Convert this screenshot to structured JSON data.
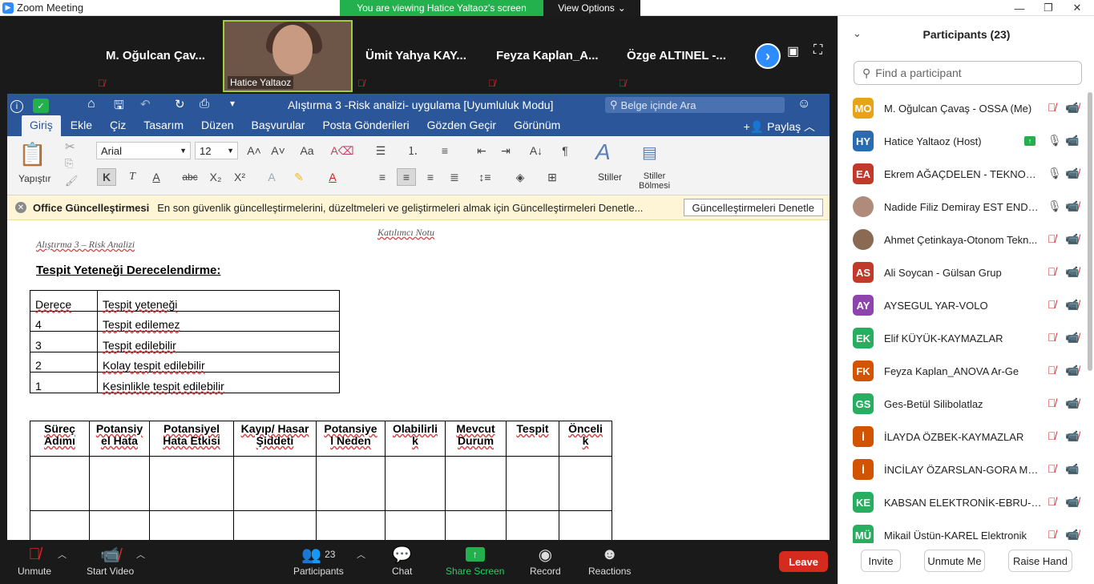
{
  "window": {
    "title": "Zoom Meeting"
  },
  "banner": {
    "viewing": "You are viewing Hatice Yaltaoz's screen",
    "view_options": "View Options"
  },
  "video_strip": {
    "tiles": [
      {
        "name": "M. Oğulcan Çav..."
      },
      {
        "name": "Hatice Yaltaoz"
      },
      {
        "name": "Ümit Yahya KAY..."
      },
      {
        "name": "Feyza  Kaplan_A..."
      },
      {
        "name": "Özge ALTINEL -..."
      }
    ]
  },
  "word": {
    "doc_title": "Alıştırma 3 -Risk analizi- uygulama [Uyumluluk Modu]",
    "search_placeholder": "Belge içinde Ara",
    "tabs": [
      "Giriş",
      "Ekle",
      "Çiz",
      "Tasarım",
      "Düzen",
      "Başvurular",
      "Posta Gönderileri",
      "Gözden Geçir",
      "Görünüm"
    ],
    "share": "Paylaş",
    "ribbon": {
      "paste": "Yapıştır",
      "font": "Arial",
      "size": "12",
      "styles": "Stiller",
      "styles_pane_1": "Stiller",
      "styles_pane_2": "Bölmesi"
    },
    "notice": {
      "title": "Office Güncelleştirmesi",
      "text": "En son güvenlik güncelleştirmelerini, düzeltmeleri ve geliştirmeleri almak için Güncelleştirmeleri Denetle...",
      "button": "Güncelleştirmeleri Denetle"
    },
    "page": {
      "header_left": "Alıştırma 3 – Risk Analizi",
      "header_right": "Katılımcı Notu",
      "heading": "Tespit Yeteneği Derecelendirme:",
      "table1": [
        [
          "Derece",
          "Tespit yeteneği"
        ],
        [
          "4",
          "Tespit edilemez"
        ],
        [
          "3",
          "Tespit edilebilir"
        ],
        [
          "2",
          "Kolay tespit edilebilir"
        ],
        [
          "1",
          "Kesinlikle tespit edilebilir"
        ]
      ],
      "table2_headers": [
        [
          "Süreç",
          "Adımı"
        ],
        [
          "Potansiy",
          "el Hata"
        ],
        [
          "Potansiyel",
          "Hata Etkisi"
        ],
        [
          "Kayıp/ Hasar",
          "Şiddeti"
        ],
        [
          "Potansiye",
          "l Neden"
        ],
        [
          "Olabilirli",
          "k"
        ],
        [
          "Mevcut",
          "Durum"
        ],
        [
          "Tespit",
          ""
        ],
        [
          "Önceli",
          "k"
        ]
      ]
    }
  },
  "participants": {
    "header": "Participants (23)",
    "search_placeholder": "Find a participant",
    "list": [
      {
        "initials": "MO",
        "name": "M. Oğulcan Çavaş - OSSA (Me)",
        "color": "#e8a317",
        "mic": "muted",
        "cam": "off"
      },
      {
        "initials": "HY",
        "name": "Hatice Yaltaoz (Host)",
        "color": "#2b6cb0",
        "mic": "on",
        "cam": "on",
        "sharing": true
      },
      {
        "initials": "EA",
        "name": "Ekrem AĞAÇDELEN - TEKNOKAR",
        "color": "#c0392b",
        "mic": "on",
        "cam": "off"
      },
      {
        "initials": "",
        "name": "Nadide Filiz Demiray EST ENDÜ...",
        "color": "#b08a7a",
        "mic": "on",
        "cam": "off",
        "photo": true
      },
      {
        "initials": "",
        "name": "Ahmet Çetinkaya-Otonom Tekn...",
        "color": "#8a6a52",
        "mic": "muted",
        "cam": "off",
        "photo": true
      },
      {
        "initials": "AS",
        "name": "Ali Soycan - Gülsan Grup",
        "color": "#c0392b",
        "mic": "muted",
        "cam": "off"
      },
      {
        "initials": "AY",
        "name": "AYSEGUL YAR-VOLO",
        "color": "#8e44ad",
        "mic": "muted",
        "cam": "off"
      },
      {
        "initials": "EK",
        "name": "Elif KÜYÜK-KAYMAZLAR",
        "color": "#27ae60",
        "mic": "muted",
        "cam": "off"
      },
      {
        "initials": "FK",
        "name": "Feyza Kaplan_ANOVA Ar-Ge",
        "color": "#d35400",
        "mic": "muted",
        "cam": "off"
      },
      {
        "initials": "GS",
        "name": "Ges-Betül Silibolatlaz",
        "color": "#27ae60",
        "mic": "muted",
        "cam": "off"
      },
      {
        "initials": "İ",
        "name": "İLAYDA ÖZBEK-KAYMAZLAR",
        "color": "#d35400",
        "mic": "muted",
        "cam": "off"
      },
      {
        "initials": "İ",
        "name": "İNCİLAY ÖZARSLAN-GORA MAK...",
        "color": "#d35400",
        "mic": "muted",
        "cam": "on"
      },
      {
        "initials": "KE",
        "name": "KABSAN ELEKTRONİK-EBRU-GİZ...",
        "color": "#27ae60",
        "mic": "muted",
        "cam": "off"
      },
      {
        "initials": "MÜ",
        "name": "Mikail Üstün-KAREL Elektronik",
        "color": "#27ae60",
        "mic": "muted",
        "cam": "off"
      }
    ],
    "footer": {
      "invite": "Invite",
      "unmute": "Unmute Me",
      "raise": "Raise Hand"
    }
  },
  "toolbar": {
    "unmute": "Unmute",
    "start_video": "Start Video",
    "participants": "Participants",
    "participants_count": "23",
    "chat": "Chat",
    "share_screen": "Share Screen",
    "record": "Record",
    "reactions": "Reactions",
    "leave": "Leave"
  }
}
